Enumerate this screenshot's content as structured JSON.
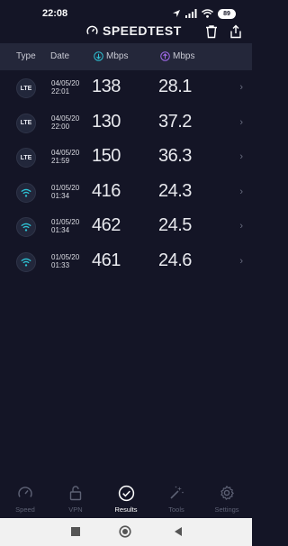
{
  "status_bar": {
    "time": "22:08",
    "battery": "89"
  },
  "header": {
    "title": "SPEEDTEST"
  },
  "table_header": {
    "type": "Type",
    "date": "Date",
    "download_unit": "Mbps",
    "upload_unit": "Mbps"
  },
  "rows": [
    {
      "type": "LTE",
      "date": "04/05/20",
      "time": "22:01",
      "download": "138",
      "upload": "28.1"
    },
    {
      "type": "LTE",
      "date": "04/05/20",
      "time": "22:00",
      "download": "130",
      "upload": "37.2"
    },
    {
      "type": "LTE",
      "date": "04/05/20",
      "time": "21:59",
      "download": "150",
      "upload": "36.3"
    },
    {
      "type": "wifi",
      "date": "01/05/20",
      "time": "01:34",
      "download": "416",
      "upload": "24.3"
    },
    {
      "type": "wifi",
      "date": "01/05/20",
      "time": "01:34",
      "download": "462",
      "upload": "24.5"
    },
    {
      "type": "wifi",
      "date": "01/05/20",
      "time": "01:33",
      "download": "461",
      "upload": "24.6"
    }
  ],
  "nav": {
    "items": [
      {
        "label": "Speed",
        "icon": "speedometer-icon"
      },
      {
        "label": "VPN",
        "icon": "lock-icon"
      },
      {
        "label": "Results",
        "icon": "check-circle-icon",
        "active": true
      },
      {
        "label": "Tools",
        "icon": "wand-icon"
      },
      {
        "label": "Settings",
        "icon": "gear-icon"
      }
    ]
  },
  "colors": {
    "background": "#141526",
    "header_bg": "#24273a",
    "download_accent": "#2ec4d6",
    "upload_accent": "#a56cf0"
  }
}
